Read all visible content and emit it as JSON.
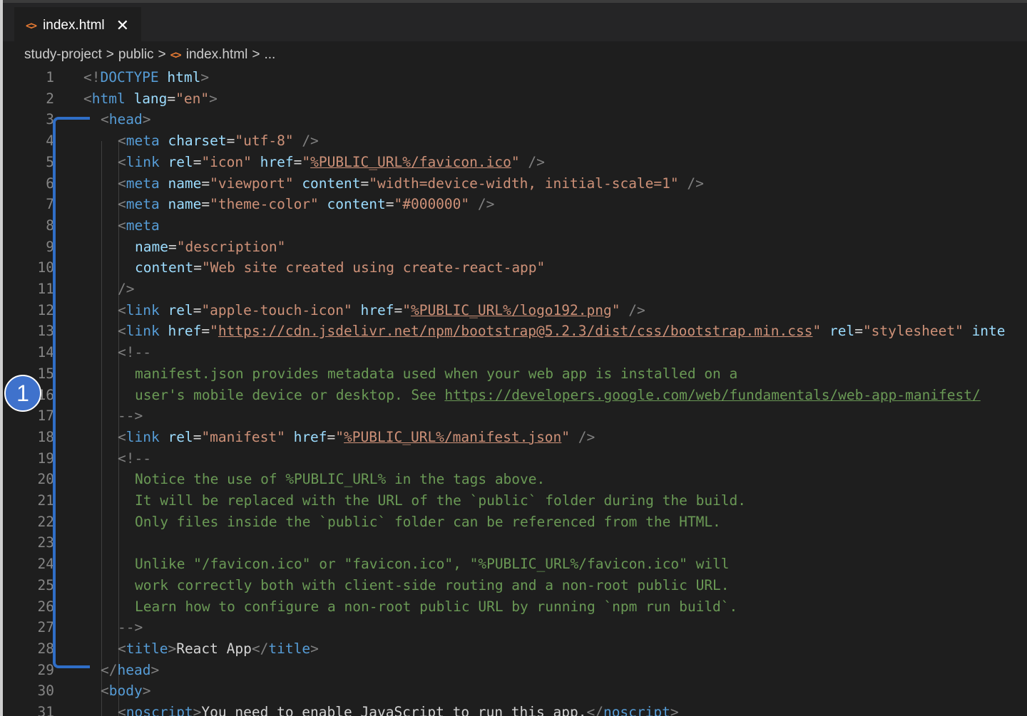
{
  "tab": {
    "title": "index.html",
    "close_glyph": "✕",
    "icon": "html-file-icon"
  },
  "breadcrumb": {
    "items": [
      "study-project",
      "public",
      "index.html",
      "..."
    ],
    "separator": ">"
  },
  "annotation": {
    "label": "1",
    "color": "#3f72cc"
  },
  "colors": {
    "tag": "#569cd6",
    "attr": "#9cdcfe",
    "string": "#ce9178",
    "comment": "#6a9955",
    "text": "#d4d4d4",
    "line_number": "#858585",
    "bracket": "#2f6ec7"
  },
  "editor": {
    "lines": [
      {
        "n": "1",
        "indent": 0,
        "segs": [
          [
            "punct",
            "<!"
          ],
          [
            "tag",
            "DOCTYPE "
          ],
          [
            "attr",
            "html"
          ],
          [
            "punct",
            ">"
          ]
        ]
      },
      {
        "n": "2",
        "indent": 0,
        "segs": [
          [
            "punct",
            "<"
          ],
          [
            "tag",
            "html "
          ],
          [
            "attr",
            "lang"
          ],
          [
            "txt",
            "="
          ],
          [
            "str",
            "\"en\""
          ],
          [
            "punct",
            ">"
          ]
        ]
      },
      {
        "n": "3",
        "indent": 1,
        "segs": [
          [
            "punct",
            "<"
          ],
          [
            "tag",
            "head"
          ],
          [
            "punct",
            ">"
          ]
        ]
      },
      {
        "n": "4",
        "indent": 2,
        "segs": [
          [
            "punct",
            "<"
          ],
          [
            "tag",
            "meta "
          ],
          [
            "attr",
            "charset"
          ],
          [
            "txt",
            "="
          ],
          [
            "str",
            "\"utf-8\""
          ],
          [
            "punct",
            " />"
          ]
        ]
      },
      {
        "n": "5",
        "indent": 2,
        "segs": [
          [
            "punct",
            "<"
          ],
          [
            "tag",
            "link "
          ],
          [
            "attr",
            "rel"
          ],
          [
            "txt",
            "="
          ],
          [
            "str",
            "\"icon\" "
          ],
          [
            "attr",
            "href"
          ],
          [
            "txt",
            "="
          ],
          [
            "str",
            "\""
          ],
          [
            "strlink",
            "%PUBLIC_URL%/favicon.ico"
          ],
          [
            "str",
            "\""
          ],
          [
            "punct",
            " />"
          ]
        ]
      },
      {
        "n": "6",
        "indent": 2,
        "segs": [
          [
            "punct",
            "<"
          ],
          [
            "tag",
            "meta "
          ],
          [
            "attr",
            "name"
          ],
          [
            "txt",
            "="
          ],
          [
            "str",
            "\"viewport\" "
          ],
          [
            "attr",
            "content"
          ],
          [
            "txt",
            "="
          ],
          [
            "str",
            "\"width=device-width, initial-scale=1\""
          ],
          [
            "punct",
            " />"
          ]
        ]
      },
      {
        "n": "7",
        "indent": 2,
        "segs": [
          [
            "punct",
            "<"
          ],
          [
            "tag",
            "meta "
          ],
          [
            "attr",
            "name"
          ],
          [
            "txt",
            "="
          ],
          [
            "str",
            "\"theme-color\" "
          ],
          [
            "attr",
            "content"
          ],
          [
            "txt",
            "="
          ],
          [
            "str",
            "\"#000000\""
          ],
          [
            "punct",
            " />"
          ]
        ]
      },
      {
        "n": "8",
        "indent": 2,
        "segs": [
          [
            "punct",
            "<"
          ],
          [
            "tag",
            "meta"
          ]
        ]
      },
      {
        "n": "9",
        "indent": 3,
        "segs": [
          [
            "attr",
            "name"
          ],
          [
            "txt",
            "="
          ],
          [
            "str",
            "\"description\""
          ]
        ]
      },
      {
        "n": "10",
        "indent": 3,
        "segs": [
          [
            "attr",
            "content"
          ],
          [
            "txt",
            "="
          ],
          [
            "str",
            "\"Web site created using create-react-app\""
          ]
        ]
      },
      {
        "n": "11",
        "indent": 2,
        "segs": [
          [
            "punct",
            "/>"
          ]
        ]
      },
      {
        "n": "12",
        "indent": 2,
        "segs": [
          [
            "punct",
            "<"
          ],
          [
            "tag",
            "link "
          ],
          [
            "attr",
            "rel"
          ],
          [
            "txt",
            "="
          ],
          [
            "str",
            "\"apple-touch-icon\" "
          ],
          [
            "attr",
            "href"
          ],
          [
            "txt",
            "="
          ],
          [
            "str",
            "\""
          ],
          [
            "strlink",
            "%PUBLIC_URL%/logo192.png"
          ],
          [
            "str",
            "\""
          ],
          [
            "punct",
            " />"
          ]
        ]
      },
      {
        "n": "13",
        "indent": 2,
        "segs": [
          [
            "punct",
            "<"
          ],
          [
            "tag",
            "link "
          ],
          [
            "attr",
            "href"
          ],
          [
            "txt",
            "="
          ],
          [
            "str",
            "\""
          ],
          [
            "strlink",
            "https://cdn.jsdelivr.net/npm/bootstrap@5.2.3/dist/css/bootstrap.min.css"
          ],
          [
            "str",
            "\" "
          ],
          [
            "attr",
            "rel"
          ],
          [
            "txt",
            "="
          ],
          [
            "str",
            "\"stylesheet\" "
          ],
          [
            "attr",
            "inte"
          ]
        ]
      },
      {
        "n": "14",
        "indent": 2,
        "segs": [
          [
            "punct",
            "<!--"
          ]
        ]
      },
      {
        "n": "15",
        "indent": 3,
        "segs": [
          [
            "cmt",
            "manifest.json provides metadata used when your web app is installed on a"
          ]
        ]
      },
      {
        "n": "16",
        "indent": 3,
        "segs": [
          [
            "cmt",
            "user's mobile device or desktop. See "
          ],
          [
            "cmtlink",
            "https://developers.google.com/web/fundamentals/web-app-manifest/"
          ]
        ]
      },
      {
        "n": "17",
        "indent": 2,
        "segs": [
          [
            "punct",
            "-->"
          ]
        ]
      },
      {
        "n": "18",
        "indent": 2,
        "segs": [
          [
            "punct",
            "<"
          ],
          [
            "tag",
            "link "
          ],
          [
            "attr",
            "rel"
          ],
          [
            "txt",
            "="
          ],
          [
            "str",
            "\"manifest\" "
          ],
          [
            "attr",
            "href"
          ],
          [
            "txt",
            "="
          ],
          [
            "str",
            "\""
          ],
          [
            "strlink",
            "%PUBLIC_URL%/manifest.json"
          ],
          [
            "str",
            "\""
          ],
          [
            "punct",
            " />"
          ]
        ]
      },
      {
        "n": "19",
        "indent": 2,
        "segs": [
          [
            "punct",
            "<!--"
          ]
        ]
      },
      {
        "n": "20",
        "indent": 3,
        "segs": [
          [
            "cmt",
            "Notice the use of %PUBLIC_URL% in the tags above."
          ]
        ]
      },
      {
        "n": "21",
        "indent": 3,
        "segs": [
          [
            "cmt",
            "It will be replaced with the URL of the `public` folder during the build."
          ]
        ]
      },
      {
        "n": "22",
        "indent": 3,
        "segs": [
          [
            "cmt",
            "Only files inside the `public` folder can be referenced from the HTML."
          ]
        ]
      },
      {
        "n": "23",
        "indent": 3,
        "segs": []
      },
      {
        "n": "24",
        "indent": 3,
        "segs": [
          [
            "cmt",
            "Unlike \"/favicon.ico\" or \"favicon.ico\", \"%PUBLIC_URL%/favicon.ico\" will"
          ]
        ]
      },
      {
        "n": "25",
        "indent": 3,
        "segs": [
          [
            "cmt",
            "work correctly both with client-side routing and a non-root public URL."
          ]
        ]
      },
      {
        "n": "26",
        "indent": 3,
        "segs": [
          [
            "cmt",
            "Learn how to configure a non-root public URL by running `npm run build`."
          ]
        ]
      },
      {
        "n": "27",
        "indent": 2,
        "segs": [
          [
            "punct",
            "-->"
          ]
        ]
      },
      {
        "n": "28",
        "indent": 2,
        "segs": [
          [
            "punct",
            "<"
          ],
          [
            "tag",
            "title"
          ],
          [
            "punct",
            ">"
          ],
          [
            "txt",
            "React App"
          ],
          [
            "punct",
            "</"
          ],
          [
            "tag",
            "title"
          ],
          [
            "punct",
            ">"
          ]
        ]
      },
      {
        "n": "29",
        "indent": 1,
        "segs": [
          [
            "punct",
            "</"
          ],
          [
            "tag",
            "head"
          ],
          [
            "punct",
            ">"
          ]
        ]
      },
      {
        "n": "30",
        "indent": 1,
        "segs": [
          [
            "punct",
            "<"
          ],
          [
            "tag",
            "body"
          ],
          [
            "punct",
            ">"
          ]
        ]
      },
      {
        "n": "31",
        "indent": 2,
        "segs": [
          [
            "punct",
            "<"
          ],
          [
            "tag",
            "noscript"
          ],
          [
            "punct",
            ">"
          ],
          [
            "txt",
            "You need to enable JavaScript to run this app."
          ],
          [
            "punct",
            "</"
          ],
          [
            "tag",
            "noscript"
          ],
          [
            "punct",
            ">"
          ]
        ]
      }
    ]
  }
}
